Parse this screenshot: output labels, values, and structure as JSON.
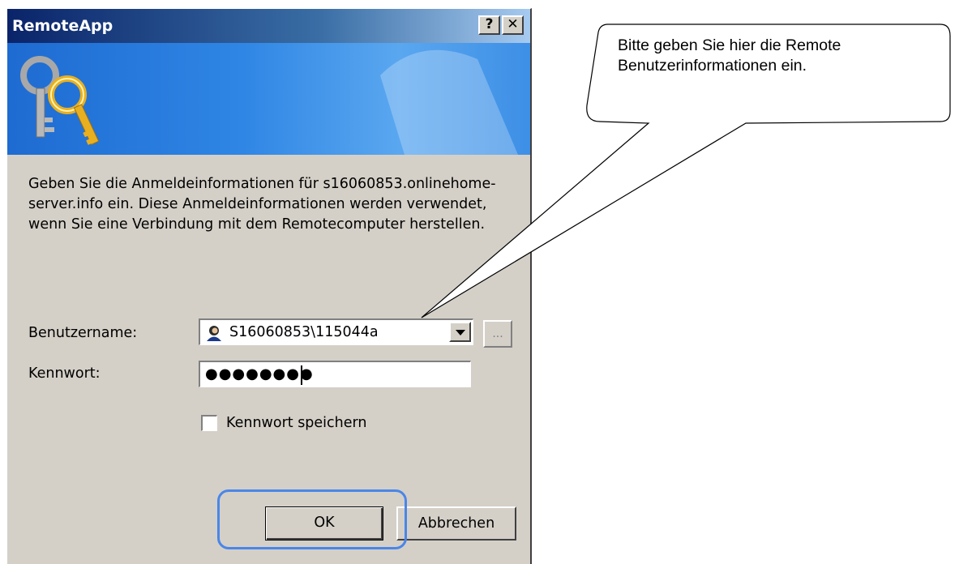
{
  "dialog": {
    "title": "RemoteApp",
    "help_button": "?",
    "close_button": "✕",
    "description": "Geben Sie die Anmeldeinformationen für s16060853.onlinehome-server.info ein. Diese Anmeldeinformationen werden verwendet, wenn Sie eine Verbindung mit dem Remotecomputer herstellen.",
    "username_label": "Benutzername:",
    "username_value": "S16060853\\115044a",
    "browse_button": "...",
    "password_label": "Kennwort:",
    "password_value": "●●●●●●●●",
    "remember_label": "Kennwort speichern",
    "remember_checked": false,
    "ok_label": "OK",
    "cancel_label": "Abbrechen"
  },
  "callout": {
    "text": "Bitte geben Sie hier die Remote Benutzerinformationen ein."
  },
  "colors": {
    "dialog_bg": "#d4d0c8",
    "titlebar": "#0a246a",
    "highlight": "#4a86e8"
  },
  "icons": {
    "banner": "keys-icon",
    "user": "user-icon"
  }
}
